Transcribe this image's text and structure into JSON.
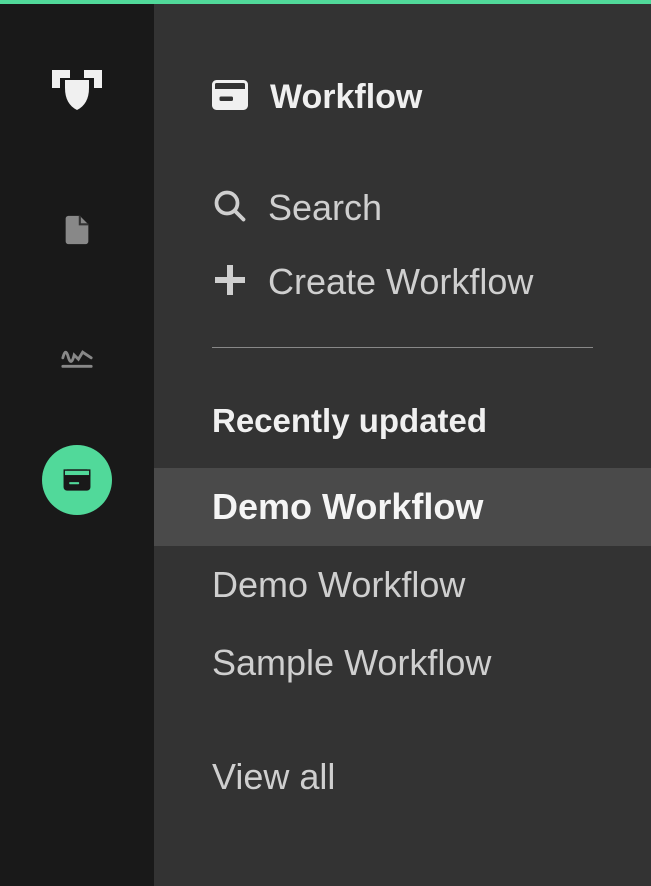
{
  "colors": {
    "accent": "#51d99a",
    "rail_bg": "#191919",
    "panel_bg": "#333333",
    "selected_row_bg": "#4a4a4a"
  },
  "rail": {
    "items": [
      {
        "icon": "logo-icon"
      },
      {
        "icon": "code-file-icon"
      },
      {
        "icon": "signature-icon"
      },
      {
        "icon": "workflow-icon",
        "active": true
      }
    ]
  },
  "panel": {
    "title": "Workflow",
    "actions": {
      "search": "Search",
      "create": "Create Workflow"
    },
    "recent": {
      "heading": "Recently updated",
      "items": [
        {
          "label": "Demo Workflow",
          "selected": true
        },
        {
          "label": "Demo Workflow",
          "selected": false
        },
        {
          "label": "Sample Workflow",
          "selected": false
        }
      ],
      "view_all": "View all"
    }
  }
}
